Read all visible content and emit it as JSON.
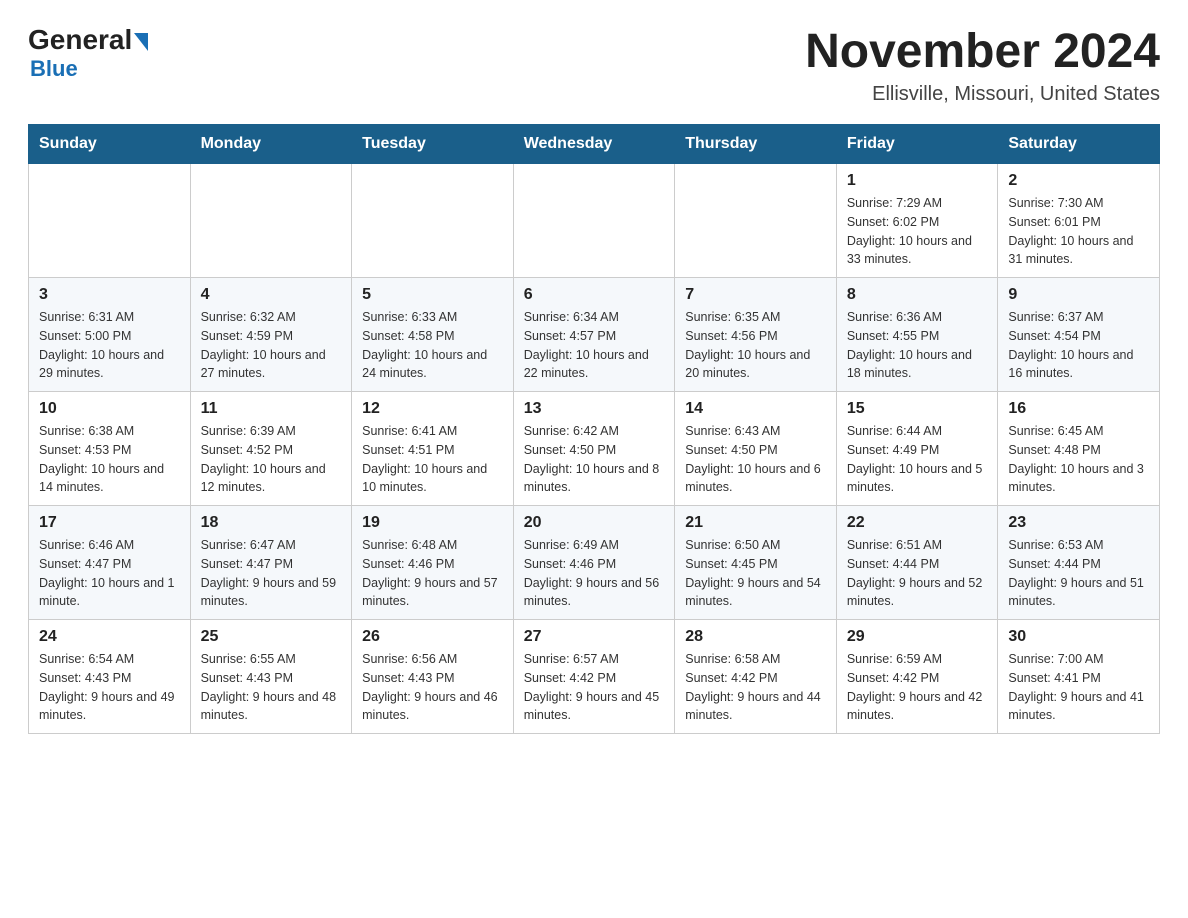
{
  "header": {
    "logo_general": "General",
    "logo_blue": "Blue",
    "month_title": "November 2024",
    "location": "Ellisville, Missouri, United States"
  },
  "days_of_week": [
    "Sunday",
    "Monday",
    "Tuesday",
    "Wednesday",
    "Thursday",
    "Friday",
    "Saturday"
  ],
  "weeks": [
    [
      {
        "day": "",
        "sunrise": "",
        "sunset": "",
        "daylight": "",
        "empty": true
      },
      {
        "day": "",
        "sunrise": "",
        "sunset": "",
        "daylight": "",
        "empty": true
      },
      {
        "day": "",
        "sunrise": "",
        "sunset": "",
        "daylight": "",
        "empty": true
      },
      {
        "day": "",
        "sunrise": "",
        "sunset": "",
        "daylight": "",
        "empty": true
      },
      {
        "day": "",
        "sunrise": "",
        "sunset": "",
        "daylight": "",
        "empty": true
      },
      {
        "day": "1",
        "sunrise": "Sunrise: 7:29 AM",
        "sunset": "Sunset: 6:02 PM",
        "daylight": "Daylight: 10 hours and 33 minutes.",
        "empty": false
      },
      {
        "day": "2",
        "sunrise": "Sunrise: 7:30 AM",
        "sunset": "Sunset: 6:01 PM",
        "daylight": "Daylight: 10 hours and 31 minutes.",
        "empty": false
      }
    ],
    [
      {
        "day": "3",
        "sunrise": "Sunrise: 6:31 AM",
        "sunset": "Sunset: 5:00 PM",
        "daylight": "Daylight: 10 hours and 29 minutes.",
        "empty": false
      },
      {
        "day": "4",
        "sunrise": "Sunrise: 6:32 AM",
        "sunset": "Sunset: 4:59 PM",
        "daylight": "Daylight: 10 hours and 27 minutes.",
        "empty": false
      },
      {
        "day": "5",
        "sunrise": "Sunrise: 6:33 AM",
        "sunset": "Sunset: 4:58 PM",
        "daylight": "Daylight: 10 hours and 24 minutes.",
        "empty": false
      },
      {
        "day": "6",
        "sunrise": "Sunrise: 6:34 AM",
        "sunset": "Sunset: 4:57 PM",
        "daylight": "Daylight: 10 hours and 22 minutes.",
        "empty": false
      },
      {
        "day": "7",
        "sunrise": "Sunrise: 6:35 AM",
        "sunset": "Sunset: 4:56 PM",
        "daylight": "Daylight: 10 hours and 20 minutes.",
        "empty": false
      },
      {
        "day": "8",
        "sunrise": "Sunrise: 6:36 AM",
        "sunset": "Sunset: 4:55 PM",
        "daylight": "Daylight: 10 hours and 18 minutes.",
        "empty": false
      },
      {
        "day": "9",
        "sunrise": "Sunrise: 6:37 AM",
        "sunset": "Sunset: 4:54 PM",
        "daylight": "Daylight: 10 hours and 16 minutes.",
        "empty": false
      }
    ],
    [
      {
        "day": "10",
        "sunrise": "Sunrise: 6:38 AM",
        "sunset": "Sunset: 4:53 PM",
        "daylight": "Daylight: 10 hours and 14 minutes.",
        "empty": false
      },
      {
        "day": "11",
        "sunrise": "Sunrise: 6:39 AM",
        "sunset": "Sunset: 4:52 PM",
        "daylight": "Daylight: 10 hours and 12 minutes.",
        "empty": false
      },
      {
        "day": "12",
        "sunrise": "Sunrise: 6:41 AM",
        "sunset": "Sunset: 4:51 PM",
        "daylight": "Daylight: 10 hours and 10 minutes.",
        "empty": false
      },
      {
        "day": "13",
        "sunrise": "Sunrise: 6:42 AM",
        "sunset": "Sunset: 4:50 PM",
        "daylight": "Daylight: 10 hours and 8 minutes.",
        "empty": false
      },
      {
        "day": "14",
        "sunrise": "Sunrise: 6:43 AM",
        "sunset": "Sunset: 4:50 PM",
        "daylight": "Daylight: 10 hours and 6 minutes.",
        "empty": false
      },
      {
        "day": "15",
        "sunrise": "Sunrise: 6:44 AM",
        "sunset": "Sunset: 4:49 PM",
        "daylight": "Daylight: 10 hours and 5 minutes.",
        "empty": false
      },
      {
        "day": "16",
        "sunrise": "Sunrise: 6:45 AM",
        "sunset": "Sunset: 4:48 PM",
        "daylight": "Daylight: 10 hours and 3 minutes.",
        "empty": false
      }
    ],
    [
      {
        "day": "17",
        "sunrise": "Sunrise: 6:46 AM",
        "sunset": "Sunset: 4:47 PM",
        "daylight": "Daylight: 10 hours and 1 minute.",
        "empty": false
      },
      {
        "day": "18",
        "sunrise": "Sunrise: 6:47 AM",
        "sunset": "Sunset: 4:47 PM",
        "daylight": "Daylight: 9 hours and 59 minutes.",
        "empty": false
      },
      {
        "day": "19",
        "sunrise": "Sunrise: 6:48 AM",
        "sunset": "Sunset: 4:46 PM",
        "daylight": "Daylight: 9 hours and 57 minutes.",
        "empty": false
      },
      {
        "day": "20",
        "sunrise": "Sunrise: 6:49 AM",
        "sunset": "Sunset: 4:46 PM",
        "daylight": "Daylight: 9 hours and 56 minutes.",
        "empty": false
      },
      {
        "day": "21",
        "sunrise": "Sunrise: 6:50 AM",
        "sunset": "Sunset: 4:45 PM",
        "daylight": "Daylight: 9 hours and 54 minutes.",
        "empty": false
      },
      {
        "day": "22",
        "sunrise": "Sunrise: 6:51 AM",
        "sunset": "Sunset: 4:44 PM",
        "daylight": "Daylight: 9 hours and 52 minutes.",
        "empty": false
      },
      {
        "day": "23",
        "sunrise": "Sunrise: 6:53 AM",
        "sunset": "Sunset: 4:44 PM",
        "daylight": "Daylight: 9 hours and 51 minutes.",
        "empty": false
      }
    ],
    [
      {
        "day": "24",
        "sunrise": "Sunrise: 6:54 AM",
        "sunset": "Sunset: 4:43 PM",
        "daylight": "Daylight: 9 hours and 49 minutes.",
        "empty": false
      },
      {
        "day": "25",
        "sunrise": "Sunrise: 6:55 AM",
        "sunset": "Sunset: 4:43 PM",
        "daylight": "Daylight: 9 hours and 48 minutes.",
        "empty": false
      },
      {
        "day": "26",
        "sunrise": "Sunrise: 6:56 AM",
        "sunset": "Sunset: 4:43 PM",
        "daylight": "Daylight: 9 hours and 46 minutes.",
        "empty": false
      },
      {
        "day": "27",
        "sunrise": "Sunrise: 6:57 AM",
        "sunset": "Sunset: 4:42 PM",
        "daylight": "Daylight: 9 hours and 45 minutes.",
        "empty": false
      },
      {
        "day": "28",
        "sunrise": "Sunrise: 6:58 AM",
        "sunset": "Sunset: 4:42 PM",
        "daylight": "Daylight: 9 hours and 44 minutes.",
        "empty": false
      },
      {
        "day": "29",
        "sunrise": "Sunrise: 6:59 AM",
        "sunset": "Sunset: 4:42 PM",
        "daylight": "Daylight: 9 hours and 42 minutes.",
        "empty": false
      },
      {
        "day": "30",
        "sunrise": "Sunrise: 7:00 AM",
        "sunset": "Sunset: 4:41 PM",
        "daylight": "Daylight: 9 hours and 41 minutes.",
        "empty": false
      }
    ]
  ]
}
